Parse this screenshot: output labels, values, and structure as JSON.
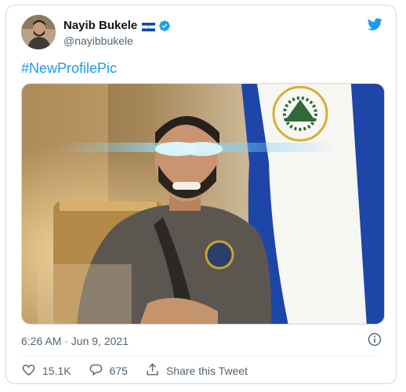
{
  "tweet": {
    "author_name": "Nayib Bukele",
    "author_handle": "@nayibbukele",
    "hashtag": "#NewProfilePic",
    "timestamp": "6:26 AM · Jun 9, 2021",
    "likes": "15.1K",
    "replies": "675",
    "share_label": "Share this Tweet"
  },
  "colors": {
    "accent": "#1d9bf0",
    "text_primary": "#0f1419",
    "text_secondary": "#536471",
    "border": "#cfd9de"
  },
  "icons": [
    "el-salvador-flag-icon",
    "verified-badge-icon",
    "twitter-bird-icon",
    "info-icon",
    "heart-icon",
    "reply-icon",
    "share-icon"
  ]
}
